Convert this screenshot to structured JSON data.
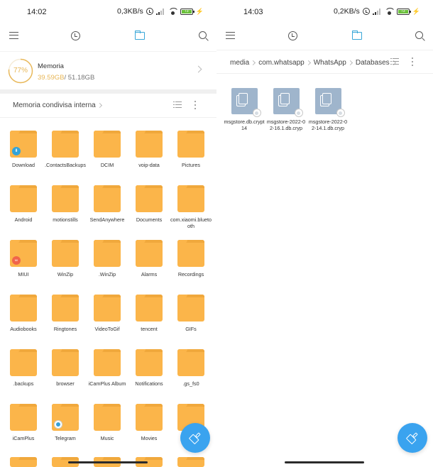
{
  "left": {
    "status": {
      "time": "14:02",
      "speed": "0,3KB/s",
      "battery": "73"
    },
    "nav": {
      "tabs": [
        "menu",
        "recent",
        "files",
        "search"
      ],
      "active": "files"
    },
    "storage": {
      "title": "Memoria",
      "percent_label": "77%",
      "percent": 77,
      "used": "39.59GB",
      "total": "/ 51.18GB"
    },
    "path": {
      "crumbs": [
        "Memoria condivisa interna"
      ]
    },
    "folders": [
      {
        "name": "Download",
        "badge": "download"
      },
      {
        "name": ".ContactsBackups"
      },
      {
        "name": "DCIM"
      },
      {
        "name": "voip-data"
      },
      {
        "name": "Pictures"
      },
      {
        "name": "Android"
      },
      {
        "name": "motionstills"
      },
      {
        "name": "SendAnywhere"
      },
      {
        "name": "Documents"
      },
      {
        "name": "com.xiaomi.bluetooth"
      },
      {
        "name": "MIUI",
        "badge": "miui"
      },
      {
        "name": "WinZip"
      },
      {
        "name": ".WinZip"
      },
      {
        "name": "Alarms"
      },
      {
        "name": "Recordings"
      },
      {
        "name": "Audiobooks"
      },
      {
        "name": "Ringtones"
      },
      {
        "name": "VideoToGif"
      },
      {
        "name": "tencent"
      },
      {
        "name": "GIFs"
      },
      {
        "name": ".backups"
      },
      {
        "name": "browser"
      },
      {
        "name": "iCamPlus Album"
      },
      {
        "name": "Notifications"
      },
      {
        "name": ".gs_fs0"
      },
      {
        "name": "iCamPlus"
      },
      {
        "name": "Telegram",
        "badge": "telegram"
      },
      {
        "name": "Music"
      },
      {
        "name": "Movies"
      },
      {
        "name": ""
      }
    ],
    "badge_text": {
      "miui": "MI"
    }
  },
  "right": {
    "status": {
      "time": "14:03",
      "speed": "0,2KB/s",
      "battery": "73"
    },
    "nav": {
      "tabs": [
        "menu",
        "recent",
        "files",
        "search"
      ],
      "active": "files"
    },
    "path": {
      "crumbs": [
        "media",
        "com.whatsapp",
        "WhatsApp",
        "Databases"
      ]
    },
    "files": [
      {
        "name": "msgstore.db.crypt14"
      },
      {
        "name": "msgstore-2022-02-16.1.db.cryp"
      },
      {
        "name": "msgstore-2022-02-14.1.db.cryp"
      }
    ]
  },
  "colors": {
    "accent": "#39a7d8",
    "folder": "#fbb54a",
    "storage_ring": "#e8b757",
    "fab": "#3aa3ef",
    "file_thumb": "#9fb5cc"
  }
}
